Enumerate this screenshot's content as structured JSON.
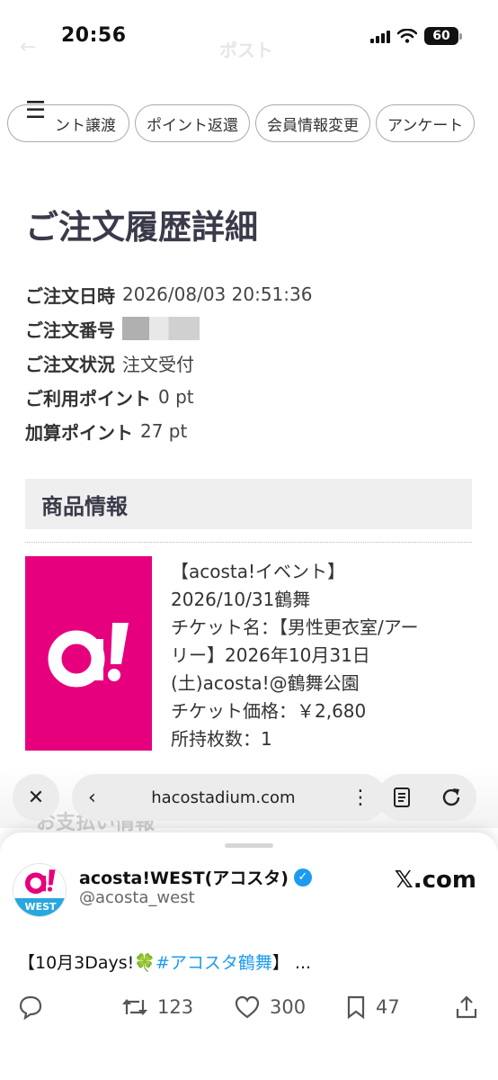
{
  "status_bar": {
    "time": "20:56",
    "battery": "60",
    "ghost_title": "ポスト",
    "ghost_back": "←"
  },
  "tabs": {
    "items": [
      "ント譲渡",
      "ポイント返還",
      "会員情報変更",
      "アンケート"
    ]
  },
  "page": {
    "title": "ご注文履歴詳細"
  },
  "order": {
    "date_label": "ご注文日時",
    "date_value": "2026/08/03 20:51:36",
    "number_label": "ご注文番号",
    "status_label": "ご注文状況",
    "status_value": "注文受付",
    "points_used_label": "ご利用ポイント",
    "points_used_value": "0 pt",
    "points_added_label": "加算ポイント",
    "points_added_value": "27 pt"
  },
  "product": {
    "section_title": "商品情報",
    "logo_text": "a!",
    "logo_color": "#e6007e",
    "lines": [
      "【acosta!イベント】",
      "2026/10/31鶴舞",
      "チケット名：【男性更衣室/アー",
      "リー】2026年10月31日",
      "(土)acosta!@鶴舞公園",
      "チケット価格：￥2,680",
      "所持枚数：1"
    ]
  },
  "browser": {
    "url": "hacostadium.com",
    "faded_heading": "お支払い情報"
  },
  "tweet_sheet": {
    "account_name": "acosta!WEST(アコスタ)",
    "handle": "@acosta_west",
    "avatar_band": "WEST",
    "avatar_logo": "a!",
    "source": "𝕏.com",
    "text_prefix": "【10月3Days!",
    "clover": "🍀",
    "hashtag": "#アコスタ鶴舞",
    "text_suffix": "】 ...",
    "retweets": "123",
    "likes": "300",
    "bookmarks": "47",
    "accent_color": "#1d9bf0"
  }
}
